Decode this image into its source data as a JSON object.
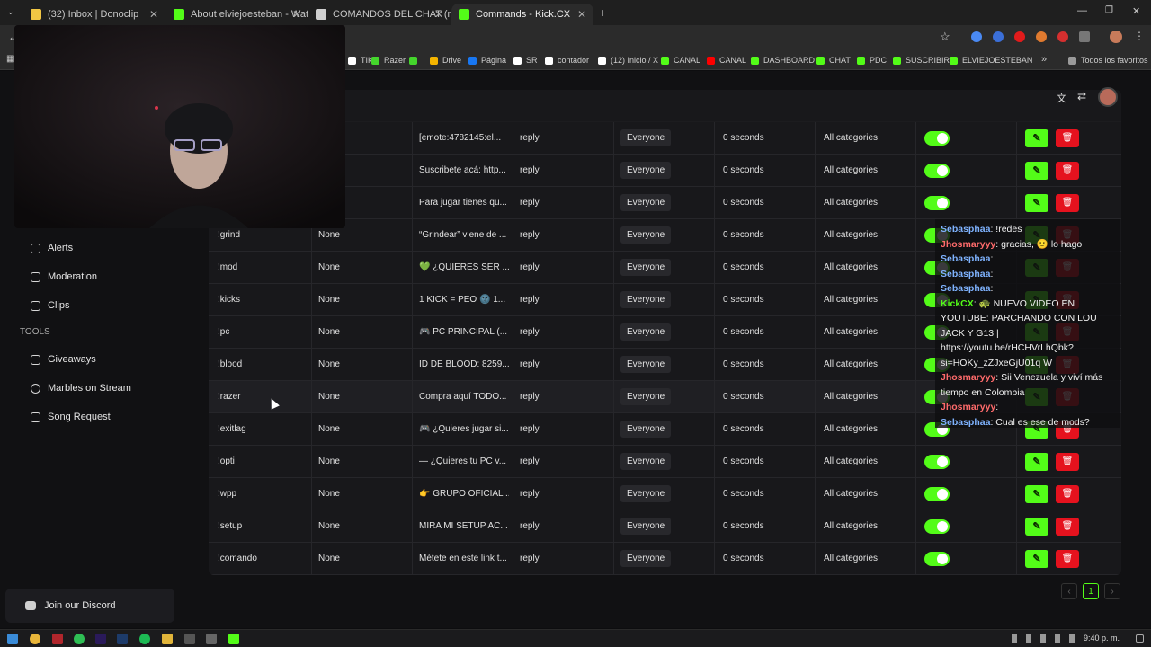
{
  "tabs": [
    {
      "label": "(32) Inbox | Donoclip",
      "color": "#f2c744"
    },
    {
      "label": "About elviejoesteban - Watch L",
      "color": "#53fc18"
    },
    {
      "label": "COMANDOS DEL CHAT (modo",
      "color": "#cfcfcf"
    },
    {
      "label": "Commands - Kick.CX",
      "color": "#53fc18"
    }
  ],
  "bookmarks": {
    "items": [
      {
        "label": "TIK",
        "color": "#ffffff"
      },
      {
        "label": "Razer",
        "color": "#44d62c"
      },
      {
        "label": "",
        "color": "#44d62c"
      },
      {
        "label": "Drive",
        "color": "#f4b400"
      },
      {
        "label": "Página",
        "color": "#1877f2"
      },
      {
        "label": "SR",
        "color": "#ffffff"
      },
      {
        "label": "contador",
        "color": "#ffffff"
      },
      {
        "label": "(12) Inicio / X",
        "color": "#ffffff"
      },
      {
        "label": "CANAL",
        "color": "#53fc18"
      },
      {
        "label": "CANAL",
        "color": "#ff0000"
      },
      {
        "label": "DASHBOARD",
        "color": "#53fc18"
      },
      {
        "label": "CHAT",
        "color": "#53fc18"
      },
      {
        "label": "PDC",
        "color": "#53fc18"
      },
      {
        "label": "SUSCRIBIR",
        "color": "#53fc18"
      },
      {
        "label": "ELVIEJOESTEBAN",
        "color": "#53fc18"
      }
    ],
    "more": "»",
    "all_favorites": "Todos los favoritos"
  },
  "sidebar": {
    "items": [
      {
        "label": "Alerts",
        "icon": "bell-icon"
      },
      {
        "label": "Moderation",
        "icon": "shield-icon"
      },
      {
        "label": "Clips",
        "icon": "clips-icon"
      }
    ],
    "tools_heading": "TOOLS",
    "tools": [
      {
        "label": "Giveaways",
        "icon": "gift-icon"
      },
      {
        "label": "Marbles on Stream",
        "icon": "marble-icon"
      },
      {
        "label": "Song Request",
        "icon": "music-icon"
      }
    ],
    "discord_label": "Join our Discord"
  },
  "commands": {
    "rows": [
      {
        "name": "",
        "alias": "",
        "response": "[emote:4782145:el...",
        "type": "reply",
        "permission": "Everyone",
        "cooldown": "0 seconds",
        "category": "All categories"
      },
      {
        "name": "",
        "alias": "",
        "response": "Suscribete acá: http...",
        "type": "reply",
        "permission": "Everyone",
        "cooldown": "0 seconds",
        "category": "All categories"
      },
      {
        "name": "",
        "alias": "",
        "response": "Para jugar tienes qu...",
        "type": "reply",
        "permission": "Everyone",
        "cooldown": "0 seconds",
        "category": "All categories"
      },
      {
        "name": "!grind",
        "alias": "None",
        "response": "“Grindear” viene de ...",
        "type": "reply",
        "permission": "Everyone",
        "cooldown": "0 seconds",
        "category": "All categories"
      },
      {
        "name": "!mod",
        "alias": "None",
        "response": "💚 ¿QUIERES SER ...",
        "type": "reply",
        "permission": "Everyone",
        "cooldown": "0 seconds",
        "category": "All categories"
      },
      {
        "name": "!kicks",
        "alias": "None",
        "response": "1 KICK = PEO 🌚 1...",
        "type": "reply",
        "permission": "Everyone",
        "cooldown": "0 seconds",
        "category": "All categories"
      },
      {
        "name": "!pc",
        "alias": "None",
        "response": "🎮 PC PRINCIPAL (...",
        "type": "reply",
        "permission": "Everyone",
        "cooldown": "0 seconds",
        "category": "All categories"
      },
      {
        "name": "!blood",
        "alias": "None",
        "response": "ID DE BLOOD: 8259...",
        "type": "reply",
        "permission": "Everyone",
        "cooldown": "0 seconds",
        "category": "All categories"
      },
      {
        "name": "!razer",
        "alias": "None",
        "response": "Compra aquí TODO...",
        "type": "reply",
        "permission": "Everyone",
        "cooldown": "0 seconds",
        "category": "All categories"
      },
      {
        "name": "!exitlag",
        "alias": "None",
        "response": "🎮 ¿Quieres jugar si...",
        "type": "reply",
        "permission": "Everyone",
        "cooldown": "0 seconds",
        "category": "All categories"
      },
      {
        "name": "!opti",
        "alias": "None",
        "response": "— ¿Quieres tu PC v...",
        "type": "reply",
        "permission": "Everyone",
        "cooldown": "0 seconds",
        "category": "All categories"
      },
      {
        "name": "!wpp",
        "alias": "None",
        "response": "👉 GRUPO OFICIAL ...",
        "type": "reply",
        "permission": "Everyone",
        "cooldown": "0 seconds",
        "category": "All categories"
      },
      {
        "name": "!setup",
        "alias": "None",
        "response": "MIRA MI SETUP AC...",
        "type": "reply",
        "permission": "Everyone",
        "cooldown": "0 seconds",
        "category": "All categories"
      },
      {
        "name": "!comando",
        "alias": "None",
        "response": "Métete en este link t...",
        "type": "reply",
        "permission": "Everyone",
        "cooldown": "0 seconds",
        "category": "All categories"
      }
    ]
  },
  "chat": {
    "messages": [
      {
        "user": "Sebasphaa",
        "text": "!redes",
        "color": "#7fb3ff"
      },
      {
        "user": "Jhosmaryyy",
        "text": "gracias, 🙂 lo hago",
        "color": "#ff6b6b"
      },
      {
        "user": "Sebasphaa",
        "text": "",
        "color": "#7fb3ff"
      },
      {
        "user": "Sebasphaa",
        "text": "",
        "color": "#7fb3ff"
      },
      {
        "user": "Sebasphaa",
        "text": "",
        "color": "#7fb3ff"
      },
      {
        "user": "KickCX",
        "text": "🐢 NUEVO VIDEO EN YOUTUBE: PARCHANDO CON LOU JACK Y G13 | https://youtu.be/rHCHVrLhQbk?si=HOKy_zZJxeGjU01q W",
        "color": "#53fc18"
      },
      {
        "user": "Jhosmaryyy",
        "text": "Sii Venezuela y viví más tiempo en Colombia",
        "color": "#ff6b6b"
      },
      {
        "user": "Jhosmaryyy",
        "text": "",
        "color": "#ff6b6b"
      },
      {
        "user": "Sebasphaa",
        "text": "Cual es ese de mods?",
        "color": "#7fb3ff"
      }
    ]
  },
  "pagination": {
    "current": "1",
    "prev": "‹",
    "next": "›"
  },
  "taskbar": {
    "time": "9:40 p. m."
  },
  "colors": {
    "accent": "#53fc18",
    "danger": "#e5121e",
    "background": "#111113"
  }
}
